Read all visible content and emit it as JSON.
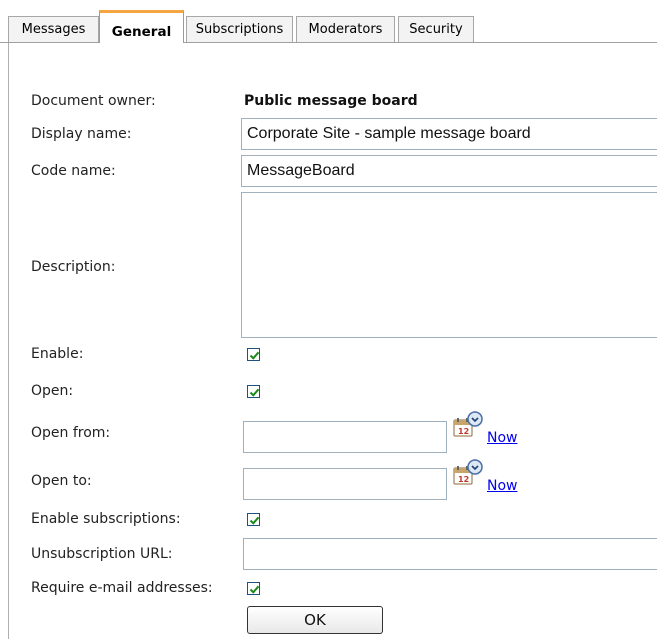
{
  "tabs": [
    {
      "label": "Messages",
      "active": false
    },
    {
      "label": "General",
      "active": true
    },
    {
      "label": "Subscriptions",
      "active": false
    },
    {
      "label": "Moderators",
      "active": false
    },
    {
      "label": "Security",
      "active": false
    }
  ],
  "form": {
    "document_owner": {
      "label": "Document owner:",
      "value": "Public message board"
    },
    "display_name": {
      "label": "Display name:",
      "value": "Corporate Site - sample message board"
    },
    "code_name": {
      "label": "Code name:",
      "value": "MessageBoard"
    },
    "description": {
      "label": "Description:",
      "value": ""
    },
    "enable": {
      "label": "Enable:",
      "checked": true
    },
    "open": {
      "label": "Open:",
      "checked": true
    },
    "open_from": {
      "label": "Open from:",
      "value": "",
      "now_link": "Now",
      "icon": "calendar-icon"
    },
    "open_to": {
      "label": "Open to:",
      "value": "",
      "now_link": "Now",
      "icon": "calendar-icon"
    },
    "enable_subscriptions": {
      "label": "Enable subscriptions:",
      "checked": true
    },
    "unsubscription_url": {
      "label": "Unsubscription URL:",
      "value": ""
    },
    "require_email": {
      "label": "Require e-mail addresses:",
      "checked": true
    }
  },
  "ok_button": {
    "label": "OK"
  },
  "colors": {
    "active_tab_accent": "#f5a542",
    "link": "#0000ee",
    "checkmark": "#1a8a1a",
    "input_border": "#9fb0bf"
  }
}
